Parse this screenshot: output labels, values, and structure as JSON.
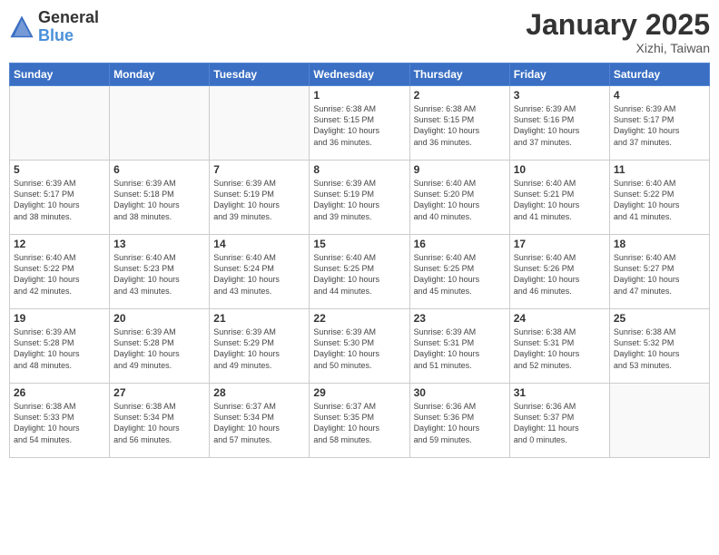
{
  "logo": {
    "general": "General",
    "blue": "Blue"
  },
  "title": "January 2025",
  "subtitle": "Xizhi, Taiwan",
  "days_of_week": [
    "Sunday",
    "Monday",
    "Tuesday",
    "Wednesday",
    "Thursday",
    "Friday",
    "Saturday"
  ],
  "weeks": [
    [
      {
        "day": "",
        "info": ""
      },
      {
        "day": "",
        "info": ""
      },
      {
        "day": "",
        "info": ""
      },
      {
        "day": "1",
        "info": "Sunrise: 6:38 AM\nSunset: 5:15 PM\nDaylight: 10 hours\nand 36 minutes."
      },
      {
        "day": "2",
        "info": "Sunrise: 6:38 AM\nSunset: 5:15 PM\nDaylight: 10 hours\nand 36 minutes."
      },
      {
        "day": "3",
        "info": "Sunrise: 6:39 AM\nSunset: 5:16 PM\nDaylight: 10 hours\nand 37 minutes."
      },
      {
        "day": "4",
        "info": "Sunrise: 6:39 AM\nSunset: 5:17 PM\nDaylight: 10 hours\nand 37 minutes."
      }
    ],
    [
      {
        "day": "5",
        "info": "Sunrise: 6:39 AM\nSunset: 5:17 PM\nDaylight: 10 hours\nand 38 minutes."
      },
      {
        "day": "6",
        "info": "Sunrise: 6:39 AM\nSunset: 5:18 PM\nDaylight: 10 hours\nand 38 minutes."
      },
      {
        "day": "7",
        "info": "Sunrise: 6:39 AM\nSunset: 5:19 PM\nDaylight: 10 hours\nand 39 minutes."
      },
      {
        "day": "8",
        "info": "Sunrise: 6:39 AM\nSunset: 5:19 PM\nDaylight: 10 hours\nand 39 minutes."
      },
      {
        "day": "9",
        "info": "Sunrise: 6:40 AM\nSunset: 5:20 PM\nDaylight: 10 hours\nand 40 minutes."
      },
      {
        "day": "10",
        "info": "Sunrise: 6:40 AM\nSunset: 5:21 PM\nDaylight: 10 hours\nand 41 minutes."
      },
      {
        "day": "11",
        "info": "Sunrise: 6:40 AM\nSunset: 5:22 PM\nDaylight: 10 hours\nand 41 minutes."
      }
    ],
    [
      {
        "day": "12",
        "info": "Sunrise: 6:40 AM\nSunset: 5:22 PM\nDaylight: 10 hours\nand 42 minutes."
      },
      {
        "day": "13",
        "info": "Sunrise: 6:40 AM\nSunset: 5:23 PM\nDaylight: 10 hours\nand 43 minutes."
      },
      {
        "day": "14",
        "info": "Sunrise: 6:40 AM\nSunset: 5:24 PM\nDaylight: 10 hours\nand 43 minutes."
      },
      {
        "day": "15",
        "info": "Sunrise: 6:40 AM\nSunset: 5:25 PM\nDaylight: 10 hours\nand 44 minutes."
      },
      {
        "day": "16",
        "info": "Sunrise: 6:40 AM\nSunset: 5:25 PM\nDaylight: 10 hours\nand 45 minutes."
      },
      {
        "day": "17",
        "info": "Sunrise: 6:40 AM\nSunset: 5:26 PM\nDaylight: 10 hours\nand 46 minutes."
      },
      {
        "day": "18",
        "info": "Sunrise: 6:40 AM\nSunset: 5:27 PM\nDaylight: 10 hours\nand 47 minutes."
      }
    ],
    [
      {
        "day": "19",
        "info": "Sunrise: 6:39 AM\nSunset: 5:28 PM\nDaylight: 10 hours\nand 48 minutes."
      },
      {
        "day": "20",
        "info": "Sunrise: 6:39 AM\nSunset: 5:28 PM\nDaylight: 10 hours\nand 49 minutes."
      },
      {
        "day": "21",
        "info": "Sunrise: 6:39 AM\nSunset: 5:29 PM\nDaylight: 10 hours\nand 49 minutes."
      },
      {
        "day": "22",
        "info": "Sunrise: 6:39 AM\nSunset: 5:30 PM\nDaylight: 10 hours\nand 50 minutes."
      },
      {
        "day": "23",
        "info": "Sunrise: 6:39 AM\nSunset: 5:31 PM\nDaylight: 10 hours\nand 51 minutes."
      },
      {
        "day": "24",
        "info": "Sunrise: 6:38 AM\nSunset: 5:31 PM\nDaylight: 10 hours\nand 52 minutes."
      },
      {
        "day": "25",
        "info": "Sunrise: 6:38 AM\nSunset: 5:32 PM\nDaylight: 10 hours\nand 53 minutes."
      }
    ],
    [
      {
        "day": "26",
        "info": "Sunrise: 6:38 AM\nSunset: 5:33 PM\nDaylight: 10 hours\nand 54 minutes."
      },
      {
        "day": "27",
        "info": "Sunrise: 6:38 AM\nSunset: 5:34 PM\nDaylight: 10 hours\nand 56 minutes."
      },
      {
        "day": "28",
        "info": "Sunrise: 6:37 AM\nSunset: 5:34 PM\nDaylight: 10 hours\nand 57 minutes."
      },
      {
        "day": "29",
        "info": "Sunrise: 6:37 AM\nSunset: 5:35 PM\nDaylight: 10 hours\nand 58 minutes."
      },
      {
        "day": "30",
        "info": "Sunrise: 6:36 AM\nSunset: 5:36 PM\nDaylight: 10 hours\nand 59 minutes."
      },
      {
        "day": "31",
        "info": "Sunrise: 6:36 AM\nSunset: 5:37 PM\nDaylight: 11 hours\nand 0 minutes."
      },
      {
        "day": "",
        "info": ""
      }
    ]
  ]
}
